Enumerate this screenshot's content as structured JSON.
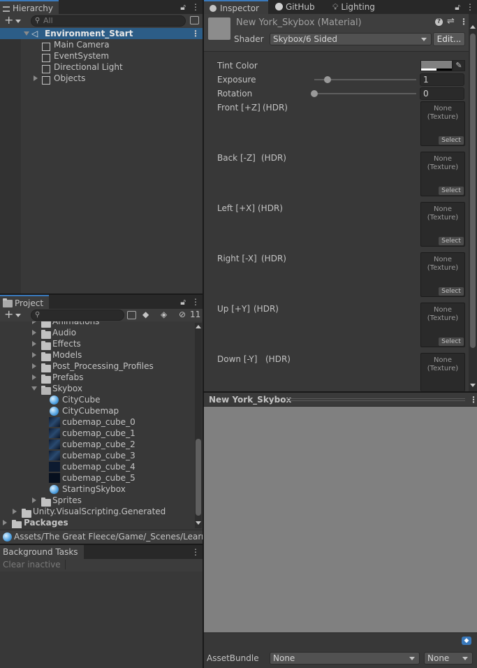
{
  "hierarchy": {
    "tab": "Hierarchy",
    "search_placeholder": "All",
    "scene": "Environment_Start",
    "items": [
      "Main Camera",
      "EventSystem",
      "Directional Light",
      "Objects"
    ]
  },
  "project": {
    "tab": "Project",
    "hidden_count": "11",
    "folders_top": [
      "Animations",
      "Audio",
      "Effects",
      "Models",
      "Post_Processing_Profiles",
      "Prefabs",
      "Skybox"
    ],
    "skybox_items": [
      "CityCube",
      "CityCubemap",
      "cubemap_cube_0",
      "cubemap_cube_1",
      "cubemap_cube_2",
      "cubemap_cube_3",
      "cubemap_cube_4",
      "cubemap_cube_5",
      "StartingSkybox"
    ],
    "folders_bottom": [
      "Sprites"
    ],
    "root_items": [
      "Unity.VisualScripting.Generated",
      "Packages"
    ],
    "path": "Assets/The Great Fleece/Game/_Scenes/Learni"
  },
  "background_tasks": {
    "tab": "Background Tasks",
    "clear_label": "Clear inactive"
  },
  "inspector": {
    "tabs": [
      "Inspector",
      "GitHub",
      "Lighting"
    ],
    "title": "New York_Skybox (Material)",
    "shader_label": "Shader",
    "shader_value": "Skybox/6 Sided",
    "edit_label": "Edit...",
    "tint_label": "Tint Color",
    "exposure_label": "Exposure",
    "exposure_value": "1",
    "exposure_level": 0.13,
    "rotation_label": "Rotation",
    "rotation_value": "0",
    "rotation_level": 0.0,
    "textures": [
      {
        "label": "Front [+Z]",
        "hdr": "(HDR)"
      },
      {
        "label": "Back [-Z]",
        "hdr": "(HDR)"
      },
      {
        "label": "Left [+X]",
        "hdr": "(HDR)"
      },
      {
        "label": "Right [-X]",
        "hdr": "(HDR)"
      },
      {
        "label": "Up [+Y]",
        "hdr": "(HDR)"
      },
      {
        "label": "Down [-Y]",
        "hdr": "(HDR)"
      }
    ],
    "tex_none": "None",
    "tex_texture": "(Texture)",
    "tex_select": "Select",
    "preview_title": "New York_Skybox",
    "assetbundle_label": "AssetBundle",
    "assetbundle_value": "None",
    "assetbundle_variant": "None"
  },
  "colors": {
    "accent": "#3a79bb",
    "panel": "#383838",
    "tabbar": "#282828",
    "preview": "#808080"
  }
}
